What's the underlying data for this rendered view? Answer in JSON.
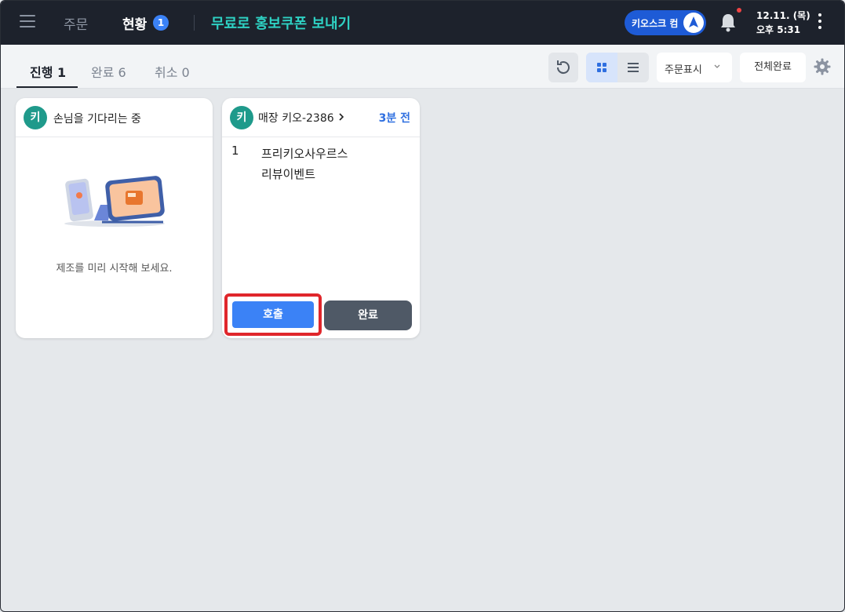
{
  "topbar": {
    "nav_order": "주문",
    "nav_status": "현황",
    "status_badge": "1",
    "coupon_link": "무료로 홍보쿠폰 보내기",
    "kiosk_label": "키오스크 컴",
    "date": "12.11. (목)",
    "time": "오후 5:31"
  },
  "tabs": [
    {
      "label": "진행 1",
      "active": true
    },
    {
      "label": "완료 6",
      "active": false
    },
    {
      "label": "취소 0",
      "active": false
    }
  ],
  "toolbar": {
    "order_display": "주문표시",
    "complete_all": "전체완료"
  },
  "waiting_card": {
    "avatar": "키",
    "title": "손님을 기다리는 중",
    "message": "제조를 미리 시작해 보세요."
  },
  "order_card": {
    "avatar": "키",
    "store": "매장 키오-2386",
    "time_ago": "3분 전",
    "items": [
      {
        "qty": "1",
        "name_line1": "프리키오사우르스",
        "name_line2": "리뷰이벤트"
      }
    ],
    "call_label": "호출",
    "done_label": "완료"
  },
  "colors": {
    "topbar_bg": "#1d222c",
    "accent_blue": "#3b82f6",
    "coupon_teal": "#2ed1c3",
    "avatar_teal": "#1f9a8b",
    "highlight_red": "#e0262b"
  }
}
